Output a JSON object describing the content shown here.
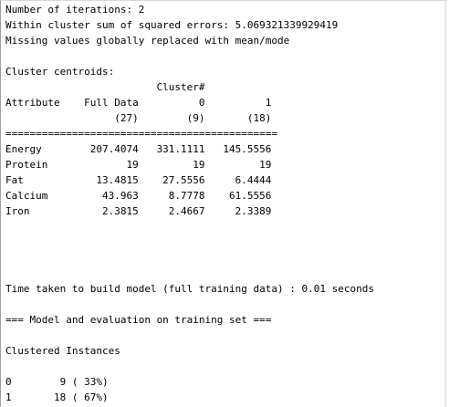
{
  "output": {
    "lines": [
      "Number of iterations: 2",
      "Within cluster sum of squared errors: 5.069321339929419",
      "Missing values globally replaced with mean/mode",
      "",
      "Cluster centroids:",
      "                         Cluster#",
      "Attribute    Full Data          0          1",
      "                  (27)        (9)       (18)",
      "=============================================",
      "Energy        207.4074   331.1111   145.5556",
      "Protein             19         19         19",
      "Fat            13.4815    27.5556     6.4444",
      "Calcium         43.963     8.7778    61.5556",
      "Iron            2.3815     2.4667     2.3389",
      "",
      "",
      "",
      "",
      "",
      "Time taken to build model (full training data) : 0.01 seconds",
      "",
      "=== Model and evaluation on training set ===",
      "",
      "Clustered Instances",
      "",
      "0        9 ( 33%)",
      "1       18 ( 67%)"
    ]
  }
}
